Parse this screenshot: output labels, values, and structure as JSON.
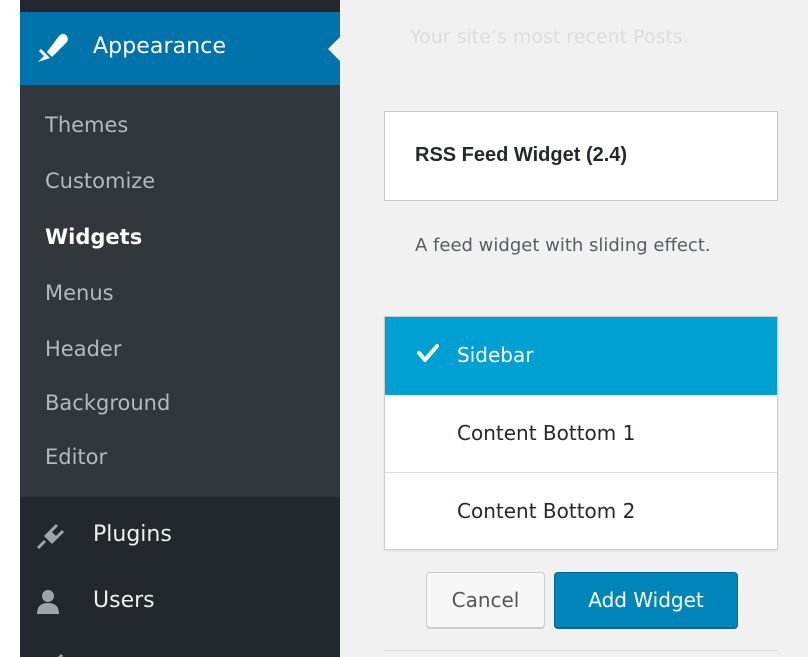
{
  "sidebar": {
    "active_menu": {
      "label": "Appearance",
      "icon": "paintbrush-icon"
    },
    "submenu": [
      {
        "label": "Themes",
        "current": false
      },
      {
        "label": "Customize",
        "current": false
      },
      {
        "label": "Widgets",
        "current": true
      },
      {
        "label": "Menus",
        "current": false
      },
      {
        "label": "Header",
        "current": false
      },
      {
        "label": "Background",
        "current": false
      },
      {
        "label": "Editor",
        "current": false
      }
    ],
    "menu_items": [
      {
        "label": "Plugins",
        "icon": "plug-icon"
      },
      {
        "label": "Users",
        "icon": "user-icon"
      }
    ]
  },
  "main": {
    "hint_text": "Your site’s most recent Posts.",
    "widget": {
      "title": "RSS Feed Widget (2.4)",
      "description": "A feed widget with sliding effect."
    },
    "areas": [
      {
        "label": "Sidebar",
        "selected": true
      },
      {
        "label": "Content Bottom 1",
        "selected": false
      },
      {
        "label": "Content Bottom 2",
        "selected": false
      }
    ],
    "buttons": {
      "cancel": "Cancel",
      "add": "Add Widget"
    }
  },
  "colors": {
    "sidebar_bg": "#23282d",
    "submenu_bg": "#32373c",
    "active_blue": "#0073aa",
    "selected_area": "#00a0d2",
    "primary_button": "#0085ba"
  }
}
